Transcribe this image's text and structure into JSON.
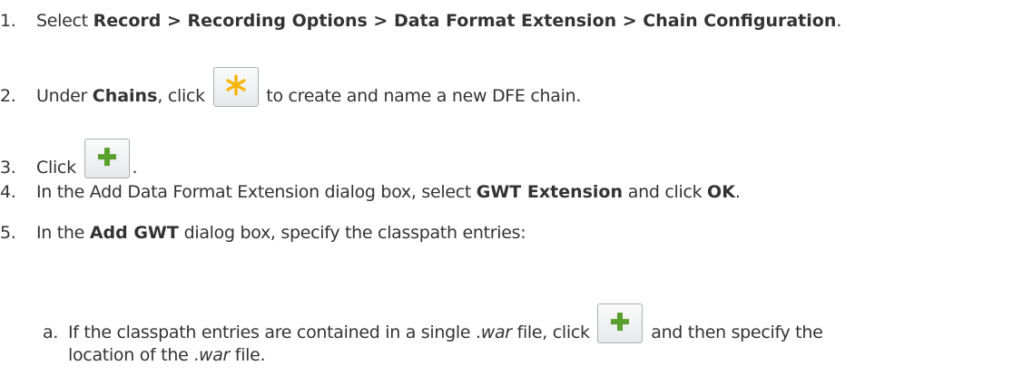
{
  "steps": [
    {
      "num": "1.",
      "pre": "Select ",
      "bold": "Record > Recording Options > Data Format Extension > Chain Configuration",
      "post": "."
    },
    {
      "num": "2.",
      "pre": "Under ",
      "bold": "Chains",
      "mid": ", click ",
      "icon": "new-chain-icon",
      "post": " to create and name a new DFE chain."
    },
    {
      "num": "3.",
      "pre": "Click ",
      "icon": "add-icon",
      "post": "."
    },
    {
      "num": "4.",
      "pre": "In the Add Data Format Extension dialog box, select ",
      "bold": "GWT Extension",
      "mid": " and click ",
      "bold2": "OK",
      "post": "."
    },
    {
      "num": "5.",
      "pre": "In the ",
      "bold": "Add GWT",
      "post": " dialog box, specify the classpath entries:"
    }
  ],
  "substep": {
    "num": "a.",
    "t1": "If the classpath entries are contained in a single .",
    "it1": "war",
    "t2": " file, click ",
    "icon": "add-icon",
    "t3": " and then specify the",
    "line2a": "location of the .",
    "it2": "war",
    "line2b": " file."
  },
  "colors": {
    "text": "#333333",
    "star": "#f5b400",
    "plus": "#5aa02c"
  }
}
